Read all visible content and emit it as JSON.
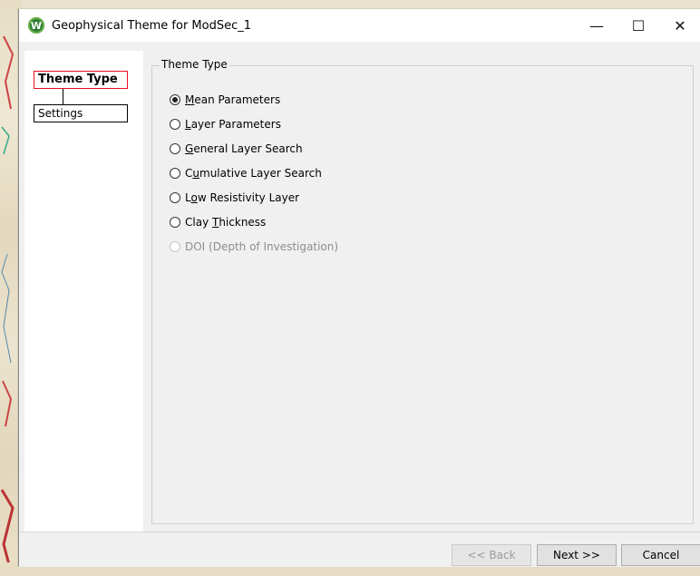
{
  "window": {
    "title": "Geophysical Theme for ModSec_1",
    "icon": "app-logo-icon",
    "controls": {
      "minimize": "—",
      "maximize": "☐",
      "close": "✕"
    }
  },
  "nav": {
    "items": [
      {
        "label": "Theme Type",
        "selected": true
      },
      {
        "label": "Settings",
        "selected": false
      }
    ]
  },
  "group": {
    "title": "Theme Type",
    "options": [
      {
        "mnemonic": "M",
        "rest": "ean Parameters",
        "checked": true,
        "enabled": true
      },
      {
        "mnemonic": "L",
        "rest": "ayer Parameters",
        "checked": false,
        "enabled": true
      },
      {
        "mnemonic": "G",
        "rest": "eneral Layer Search",
        "checked": false,
        "enabled": true
      },
      {
        "pre": "C",
        "mnemonic": "u",
        "rest": "mulative Layer Search",
        "checked": false,
        "enabled": true
      },
      {
        "pre": "L",
        "mnemonic": "o",
        "rest": "w Resistivity Layer",
        "checked": false,
        "enabled": true
      },
      {
        "pre": "Clay ",
        "mnemonic": "T",
        "rest": "hickness",
        "checked": false,
        "enabled": true
      },
      {
        "label": "DOI (Depth of Investigation)",
        "checked": false,
        "enabled": false
      }
    ]
  },
  "footer": {
    "back": "<< Back",
    "next": "Next >>",
    "cancel": "Cancel"
  },
  "colors": {
    "selected_border": "#e81123",
    "app_icon": "#2e7d32"
  }
}
